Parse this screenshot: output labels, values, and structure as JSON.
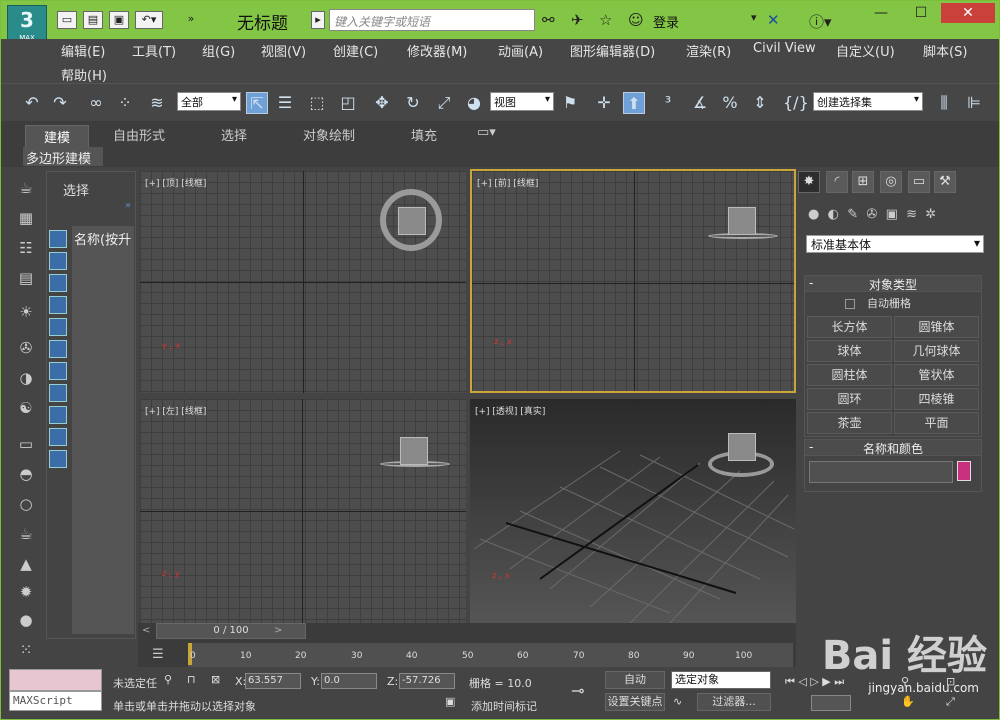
{
  "window": {
    "title": "无标题",
    "logo_text": "MAX",
    "search_placeholder": "键入关键字或短语",
    "login": "登录"
  },
  "menus": [
    "编辑(E)",
    "工具(T)",
    "组(G)",
    "视图(V)",
    "创建(C)",
    "修改器(M)",
    "动画(A)",
    "图形编辑器(D)",
    "渲染(R)",
    "Civil View",
    "自定义(U)",
    "脚本(S)",
    "帮助(H)"
  ],
  "toolbar": {
    "filter_select": "全部",
    "ref_coord": "视图",
    "selection_set": "创建选择集"
  },
  "ribbon": {
    "tabs": [
      "建模",
      "自由形式",
      "选择",
      "对象绘制",
      "填充"
    ],
    "active": "建模",
    "subtab": "多边形建模"
  },
  "scene_explorer": {
    "title": "选择",
    "column": "名称(按升"
  },
  "viewports": [
    {
      "label": "[+] [顶] [线框]"
    },
    {
      "label": "[+] [前] [线框]"
    },
    {
      "label": "[+] [左] [线框]"
    },
    {
      "label": "[+] [透视] [真实]"
    }
  ],
  "command_panel": {
    "category_dropdown": "标准基本体",
    "object_type_title": "对象类型",
    "autogrid": "自动栅格",
    "buttons": [
      "长方体",
      "圆锥体",
      "球体",
      "几何球体",
      "圆柱体",
      "管状体",
      "圆环",
      "四棱锥",
      "茶壶",
      "平面"
    ],
    "name_color_title": "名称和颜色",
    "color": "#c8317e"
  },
  "timeline": {
    "slider": "0 / 100",
    "ticks": [
      "0",
      "10",
      "20",
      "30",
      "40",
      "50",
      "60",
      "70",
      "80",
      "90",
      "100"
    ]
  },
  "status": {
    "maxscript": "MAXScript",
    "selection": "未选定任",
    "prompt": "单击或单击并拖动以选择对象",
    "x": "63.557",
    "y": "0.0",
    "z": "-57.726",
    "grid": "栅格 = 10.0",
    "add_time_tag": "添加时间标记",
    "auto": "自动",
    "set_key": "设置关键点",
    "selected_object": "选定对象",
    "filter": "过滤器..."
  },
  "watermark": {
    "logo": "Bai 经验",
    "url": "jingyan.baidu.com"
  }
}
